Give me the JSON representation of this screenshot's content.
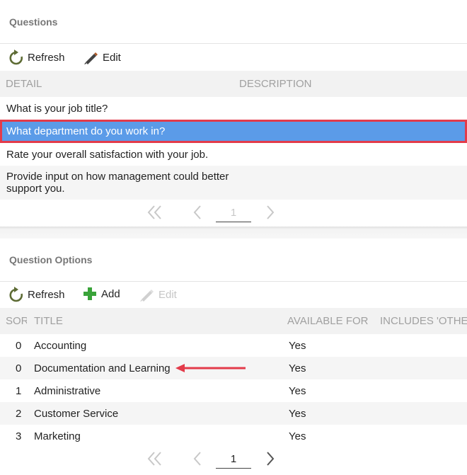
{
  "questions": {
    "title": "Questions",
    "toolbar": {
      "refresh_label": "Refresh",
      "edit_label": "Edit"
    },
    "columns": [
      "DETAIL",
      "DESCRIPTION"
    ],
    "rows": [
      {
        "detail": "What is your job title?",
        "description": ""
      },
      {
        "detail": "What department do you work in?",
        "description": "",
        "selected": true
      },
      {
        "detail": "Rate your overall satisfaction with your job.",
        "description": ""
      },
      {
        "detail": "Provide input on how management could better support you.",
        "description": ""
      }
    ],
    "pager": {
      "page": "1"
    }
  },
  "options": {
    "title": "Question Options",
    "toolbar": {
      "refresh_label": "Refresh",
      "add_label": "Add",
      "edit_label": "Edit"
    },
    "columns": [
      "SORT",
      "TITLE",
      "AVAILABLE FOR",
      "INCLUDES 'OTHER'"
    ],
    "rows": [
      {
        "sort": "0",
        "title": "Accounting",
        "available": "Yes"
      },
      {
        "sort": "0",
        "title": "Documentation and Learning",
        "available": "Yes"
      },
      {
        "sort": "1",
        "title": "Administrative",
        "available": "Yes"
      },
      {
        "sort": "2",
        "title": "Customer Service",
        "available": "Yes"
      },
      {
        "sort": "3",
        "title": "Marketing",
        "available": "Yes"
      }
    ],
    "pager": {
      "page": "1"
    }
  },
  "colors": {
    "selected_row": "#5b9be8",
    "selected_outline": "#e33b4a",
    "annotation_arrow": "#e33b4a",
    "add_icon": "#3aa33a",
    "refresh_icon": "#5d6b34"
  }
}
